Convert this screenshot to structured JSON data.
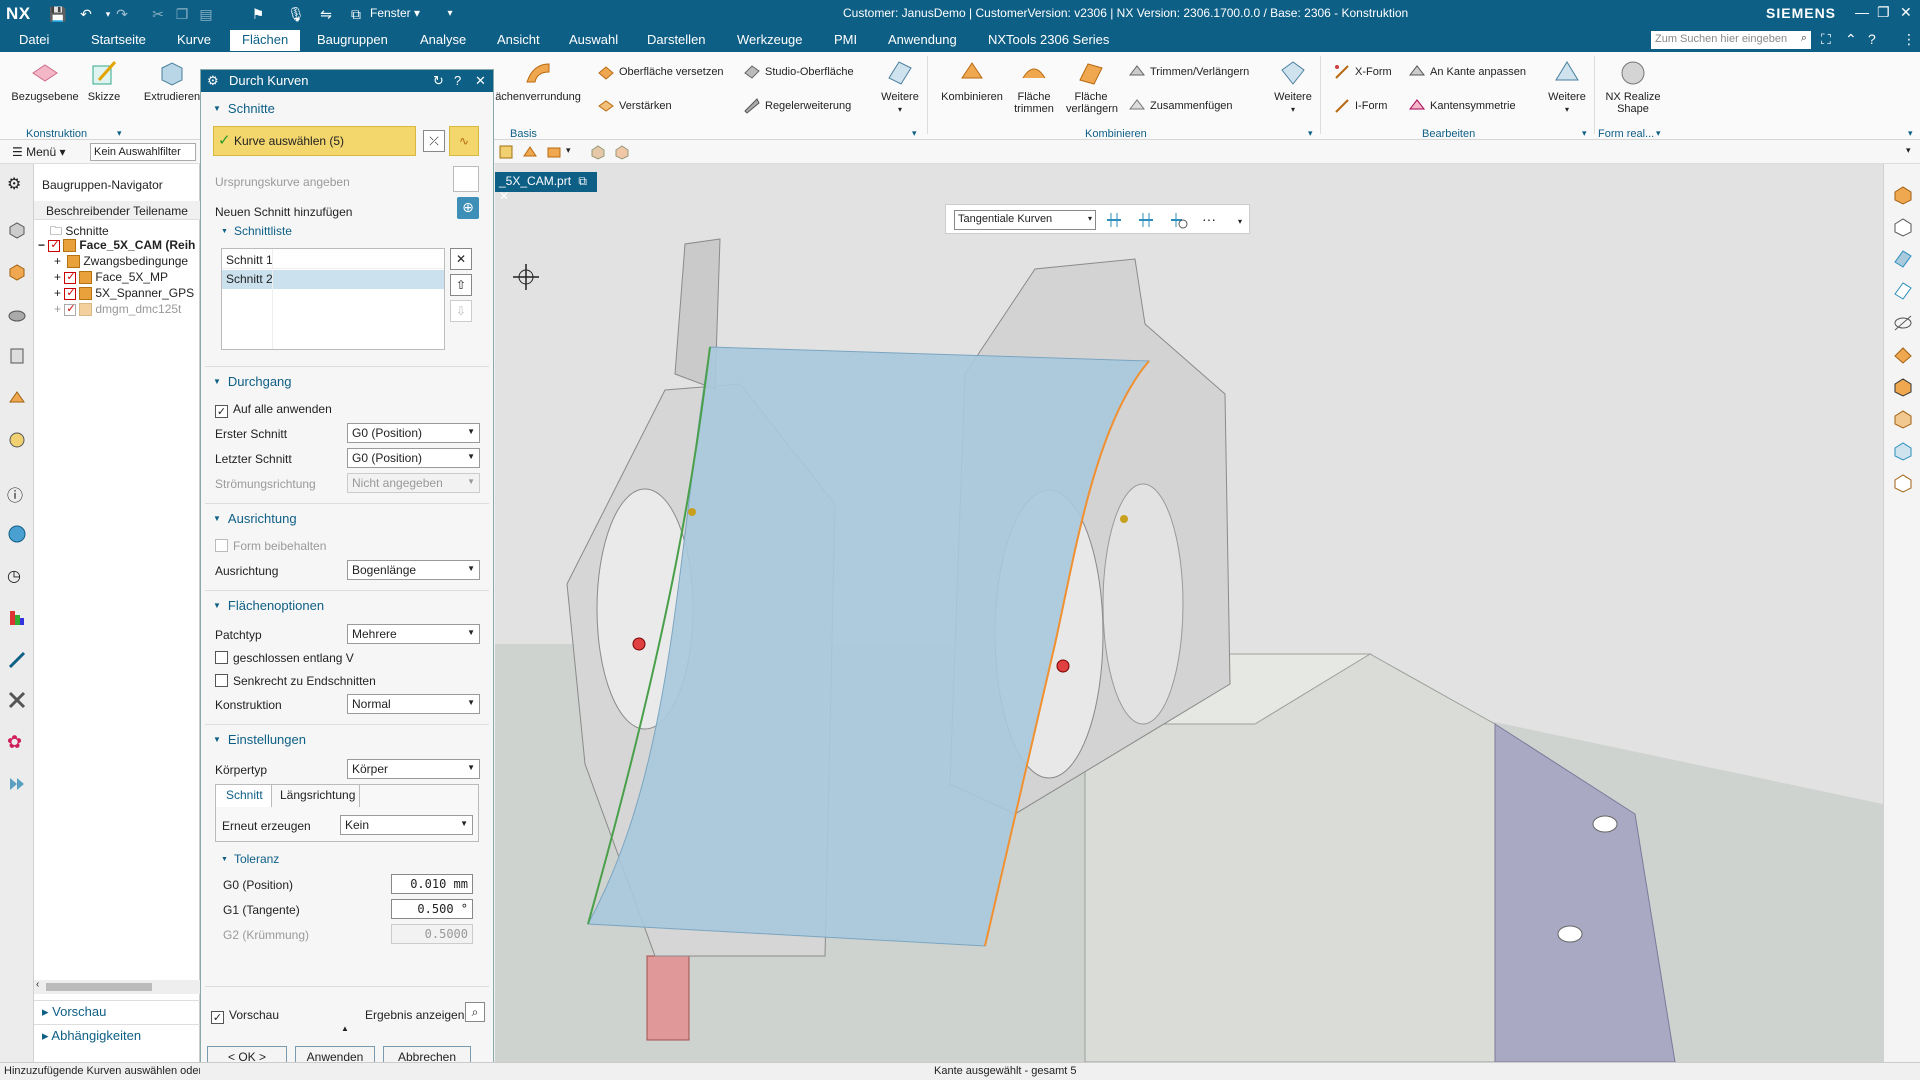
{
  "titlebar": {
    "logo": "NX",
    "window_menu": "Fenster",
    "title": "Customer: JanusDemo | CustomerVersion: v2306 | NX Version: 2306.1700.0.0 / Base: 2306 - Konstruktion",
    "brand": "SIEMENS"
  },
  "menubar": {
    "items": [
      "Datei",
      "Startseite",
      "Kurve",
      "Flächen",
      "Baugruppen",
      "Analyse",
      "Ansicht",
      "Auswahl",
      "Darstellen",
      "Werkzeuge",
      "PMI",
      "Anwendung",
      "NXTools 2306 Series"
    ],
    "active": "Flächen",
    "search_placeholder": "Zum Suchen hier eingeben"
  },
  "ribbon": {
    "btn_bezugsebene": "Bezugsebene",
    "btn_skizze": "Skizze",
    "btn_extrudieren": "Extrudieren",
    "grp_konstruktion": "Konstruktion",
    "btn_flaechenverrundung": "ächenverrundung",
    "btn_oberflaeche_versetzen": "Oberfläche versetzen",
    "btn_verstaerken": "Verstärken",
    "btn_studio_oberflaeche": "Studio-Oberfläche",
    "btn_regelerweiterung": "Regelerweiterung",
    "btn_weitere1": "Weitere",
    "grp_basis": "Basis",
    "btn_kombinieren": "Kombinieren",
    "btn_flaeche_trimmen_1": "Fläche",
    "btn_flaeche_trimmen_2": "trimmen",
    "btn_flaeche_verlaengern_1": "Fläche",
    "btn_flaeche_verlaengern_2": "verlängern",
    "btn_trimmen_verlaengern": "Trimmen/Verlängern",
    "btn_zusammenfuegen": "Zusammenfügen",
    "btn_weitere2": "Weitere",
    "grp_kombinieren": "Kombinieren",
    "btn_xform": "X-Form",
    "btn_iform": "I-Form",
    "btn_an_kante_anpassen": "An Kante anpassen",
    "btn_kantensymmetrie": "Kantensymmetrie",
    "btn_weitere3": "Weitere",
    "grp_bearbeiten": "Bearbeiten",
    "btn_nx_realize_1": "NX Realize",
    "btn_nx_realize_2": "Shape",
    "grp_form_real": "Form real..."
  },
  "toolbar2": {
    "menu": "Menü",
    "filter": "Kein Auswahlfilter"
  },
  "navigator": {
    "title": "Baugruppen-Navigator",
    "column": "Beschreibender Teilename",
    "rows": [
      "Schnitte",
      "Face_5X_CAM (Reih",
      "Zwangsbedingunge",
      "Face_5X_MP",
      "5X_Spanner_GPS",
      "dmgm_dmc125t"
    ],
    "bottom1": "Vorschau",
    "bottom2": "Abhängigkeiten"
  },
  "dialog": {
    "title": "Durch Kurven",
    "sec_schnitte": "Schnitte",
    "select_curve": "Kurve auswählen (5)",
    "origin_curve": "Ursprungskurve angeben",
    "add_section": "Neuen Schnitt hinzufügen",
    "section_list_head": "Schnittliste",
    "section_list": [
      "Schnitt 1",
      "Schnitt 2"
    ],
    "sec_durchgang": "Durchgang",
    "apply_all": "Auf alle anwenden",
    "first_section_label": "Erster Schnitt",
    "first_section_value": "G0 (Position)",
    "last_section_label": "Letzter Schnitt",
    "last_section_value": "G0 (Position)",
    "flow_dir_label": "Strömungsrichtung",
    "flow_dir_value": "Nicht angegeben",
    "sec_ausrichtung": "Ausrichtung",
    "keep_shape": "Form beibehalten",
    "alignment_label": "Ausrichtung",
    "alignment_value": "Bogenlänge",
    "sec_flaechenoptionen": "Flächenoptionen",
    "patch_label": "Patchtyp",
    "patch_value": "Mehrere",
    "closed_v": "geschlossen entlang V",
    "perp_end": "Senkrecht zu Endschnitten",
    "construction_label": "Konstruktion",
    "construction_value": "Normal",
    "sec_einstellungen": "Einstellungen",
    "body_type_label": "Körpertyp",
    "body_type_value": "Körper",
    "tab_schnitt": "Schnitt",
    "tab_laengs": "Längsrichtung",
    "regen_label": "Erneut erzeugen",
    "regen_value": "Kein",
    "tol_head": "Toleranz",
    "g0_label": "G0 (Position)",
    "g0_value": "0.010 mm",
    "g1_label": "G1 (Tangente)",
    "g1_value": "0.500 °",
    "g2_label": "G2 (Krümmung)",
    "g2_value": "0.5000",
    "preview": "Vorschau",
    "show_result": "Ergebnis anzeigen",
    "ok": "< OK >",
    "apply": "Anwenden",
    "cancel": "Abbrechen"
  },
  "viewport": {
    "tab": "_5X_CAM.prt",
    "curve_rule": "Tangentiale Kurven",
    "more": "···"
  },
  "statusbar": {
    "left": "Hinzuzufügende Kurven auswählen oder",
    "center": "Kante ausgewählt - gesamt 5"
  },
  "colors": {
    "accent": "#0e5f86",
    "selection_yellow": "#f3d66c",
    "surface": "#a9c9dd"
  }
}
